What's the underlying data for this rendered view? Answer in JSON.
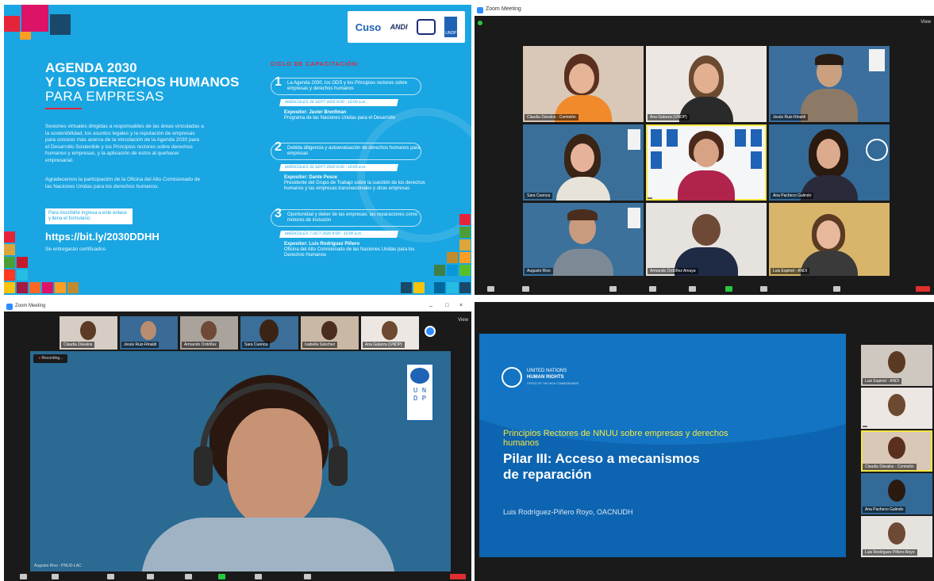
{
  "poster": {
    "logos": [
      "Cuso",
      "ANDI",
      "UNDP"
    ],
    "title_line1": "AGENDA 2030",
    "title_line2": "Y LOS DERECHOS HUMANOS",
    "title_line3": "PARA EMPRESAS",
    "intro": "Sesiones virtuales dirigidas a responsables de las áreas vinculadas a la sostenibilidad, los asuntos legales y la reputación de empresas para conocer más acerca de la vinculación de la Agenda 2030 para el Desarrollo Sostenible y los Principios rectores sobre derechos humanos y empresas, y la aplicación de estos al quehacer empresarial.",
    "thanks": "Agradecemos la participación de la Oficina del Alto Comisionado de las Naciones Unidas para los derechos humanos.",
    "register_box": "Para inscribirte ingresa a este enlace y llena el formulario:",
    "link": "https://bit.ly/2030DDHH",
    "certificate": "Se entregarán certificados",
    "cycle_title": "CICLO DE CAPACITACIÓN:",
    "steps": [
      {
        "num": "1",
        "text": "La Agenda 2030, los ODS y los Principios rectores sobre empresas y derechos humanos",
        "date": "MIÉRCOLES 26 SEPT 2020 9:00 - 10:00 a.m.",
        "speaker": "Expositor: Javier Brenfman",
        "speaker_desc": "Programa de las Naciones Unidas para el Desarrollo"
      },
      {
        "num": "2",
        "text": "Debida diligencia y autoevaluación de derechos humanos para empresas",
        "date": "MIÉRCOLES 30 SEPT 2020 9:00 - 10:00 a.m.",
        "speaker": "Expositor: Dante Pesce",
        "speaker_desc": "Presidente del Grupo de Trabajo sobre la cuestión de los derechos humanos y las empresas transnacionales y otras empresas"
      },
      {
        "num": "3",
        "text": "Oportunidad y deber de las empresas: las reparaciones como motores de inclusión",
        "date": "MIÉRCOLES 7 OCT 2020 9:00 - 10:00 a.m.",
        "speaker": "Expositor: Luis Rodríguez Piñero",
        "speaker_desc": "Oficina del Alto Comisionado de las Naciones Unidas para los Derechos Humanos"
      }
    ]
  },
  "zoom1": {
    "window_title": "Zoom Meeting",
    "view_label": "View",
    "participants": [
      "Claudia Dávalos - Comisión",
      "Ana Galarza (UNDP)",
      "Jesús Ruiz-Rinaldi",
      "Sara Cuenca",
      "",
      "Ana Pacheco Galindo",
      "Augusto Rivo",
      "Armando Ordóñez Amaya",
      "Luis Espinel - ANDI"
    ]
  },
  "zoom2": {
    "window_title": "Zoom Meeting",
    "view_label": "View",
    "recording_label": "Recording...",
    "speaker_name": "Augusto Rivo - PNUD-LAC",
    "strip": [
      "Claudia Dávalos",
      "Jesús Ruiz-Rinaldi",
      "Armando Ordóñez",
      "Sara Cuenca",
      "Isabella Sánchez",
      "Ana Galarza (UNDP)"
    ],
    "undp_letters": [
      "U",
      "N",
      "D",
      "P"
    ]
  },
  "zoom3": {
    "org_line1": "UNITED NATIONS",
    "org_line2": "HUMAN RIGHTS",
    "org_line3": "OFFICE OF THE HIGH COMMISSIONER",
    "slide_subtitle": "Principios Rectores de NNUU sobre empresas y derechos humanos",
    "slide_title_1": "Pilar III: Acceso a mecanismos",
    "slide_title_2": "de reparación",
    "slide_author": "Luis Rodríguez-Piñero Royo, OACNUDH",
    "strip": [
      "Luis Espinel - ANDI",
      "",
      "Claudia Dávalos - Comisión",
      "Ana Pacheco Galindo",
      "Luis Rodríguez Piñero Royo"
    ]
  },
  "colors": {
    "poster_blue": "#1aa6e2",
    "slide_blue": "#0d64b0",
    "active_speaker": "#f5e642",
    "leave_red": "#e02f2f"
  }
}
